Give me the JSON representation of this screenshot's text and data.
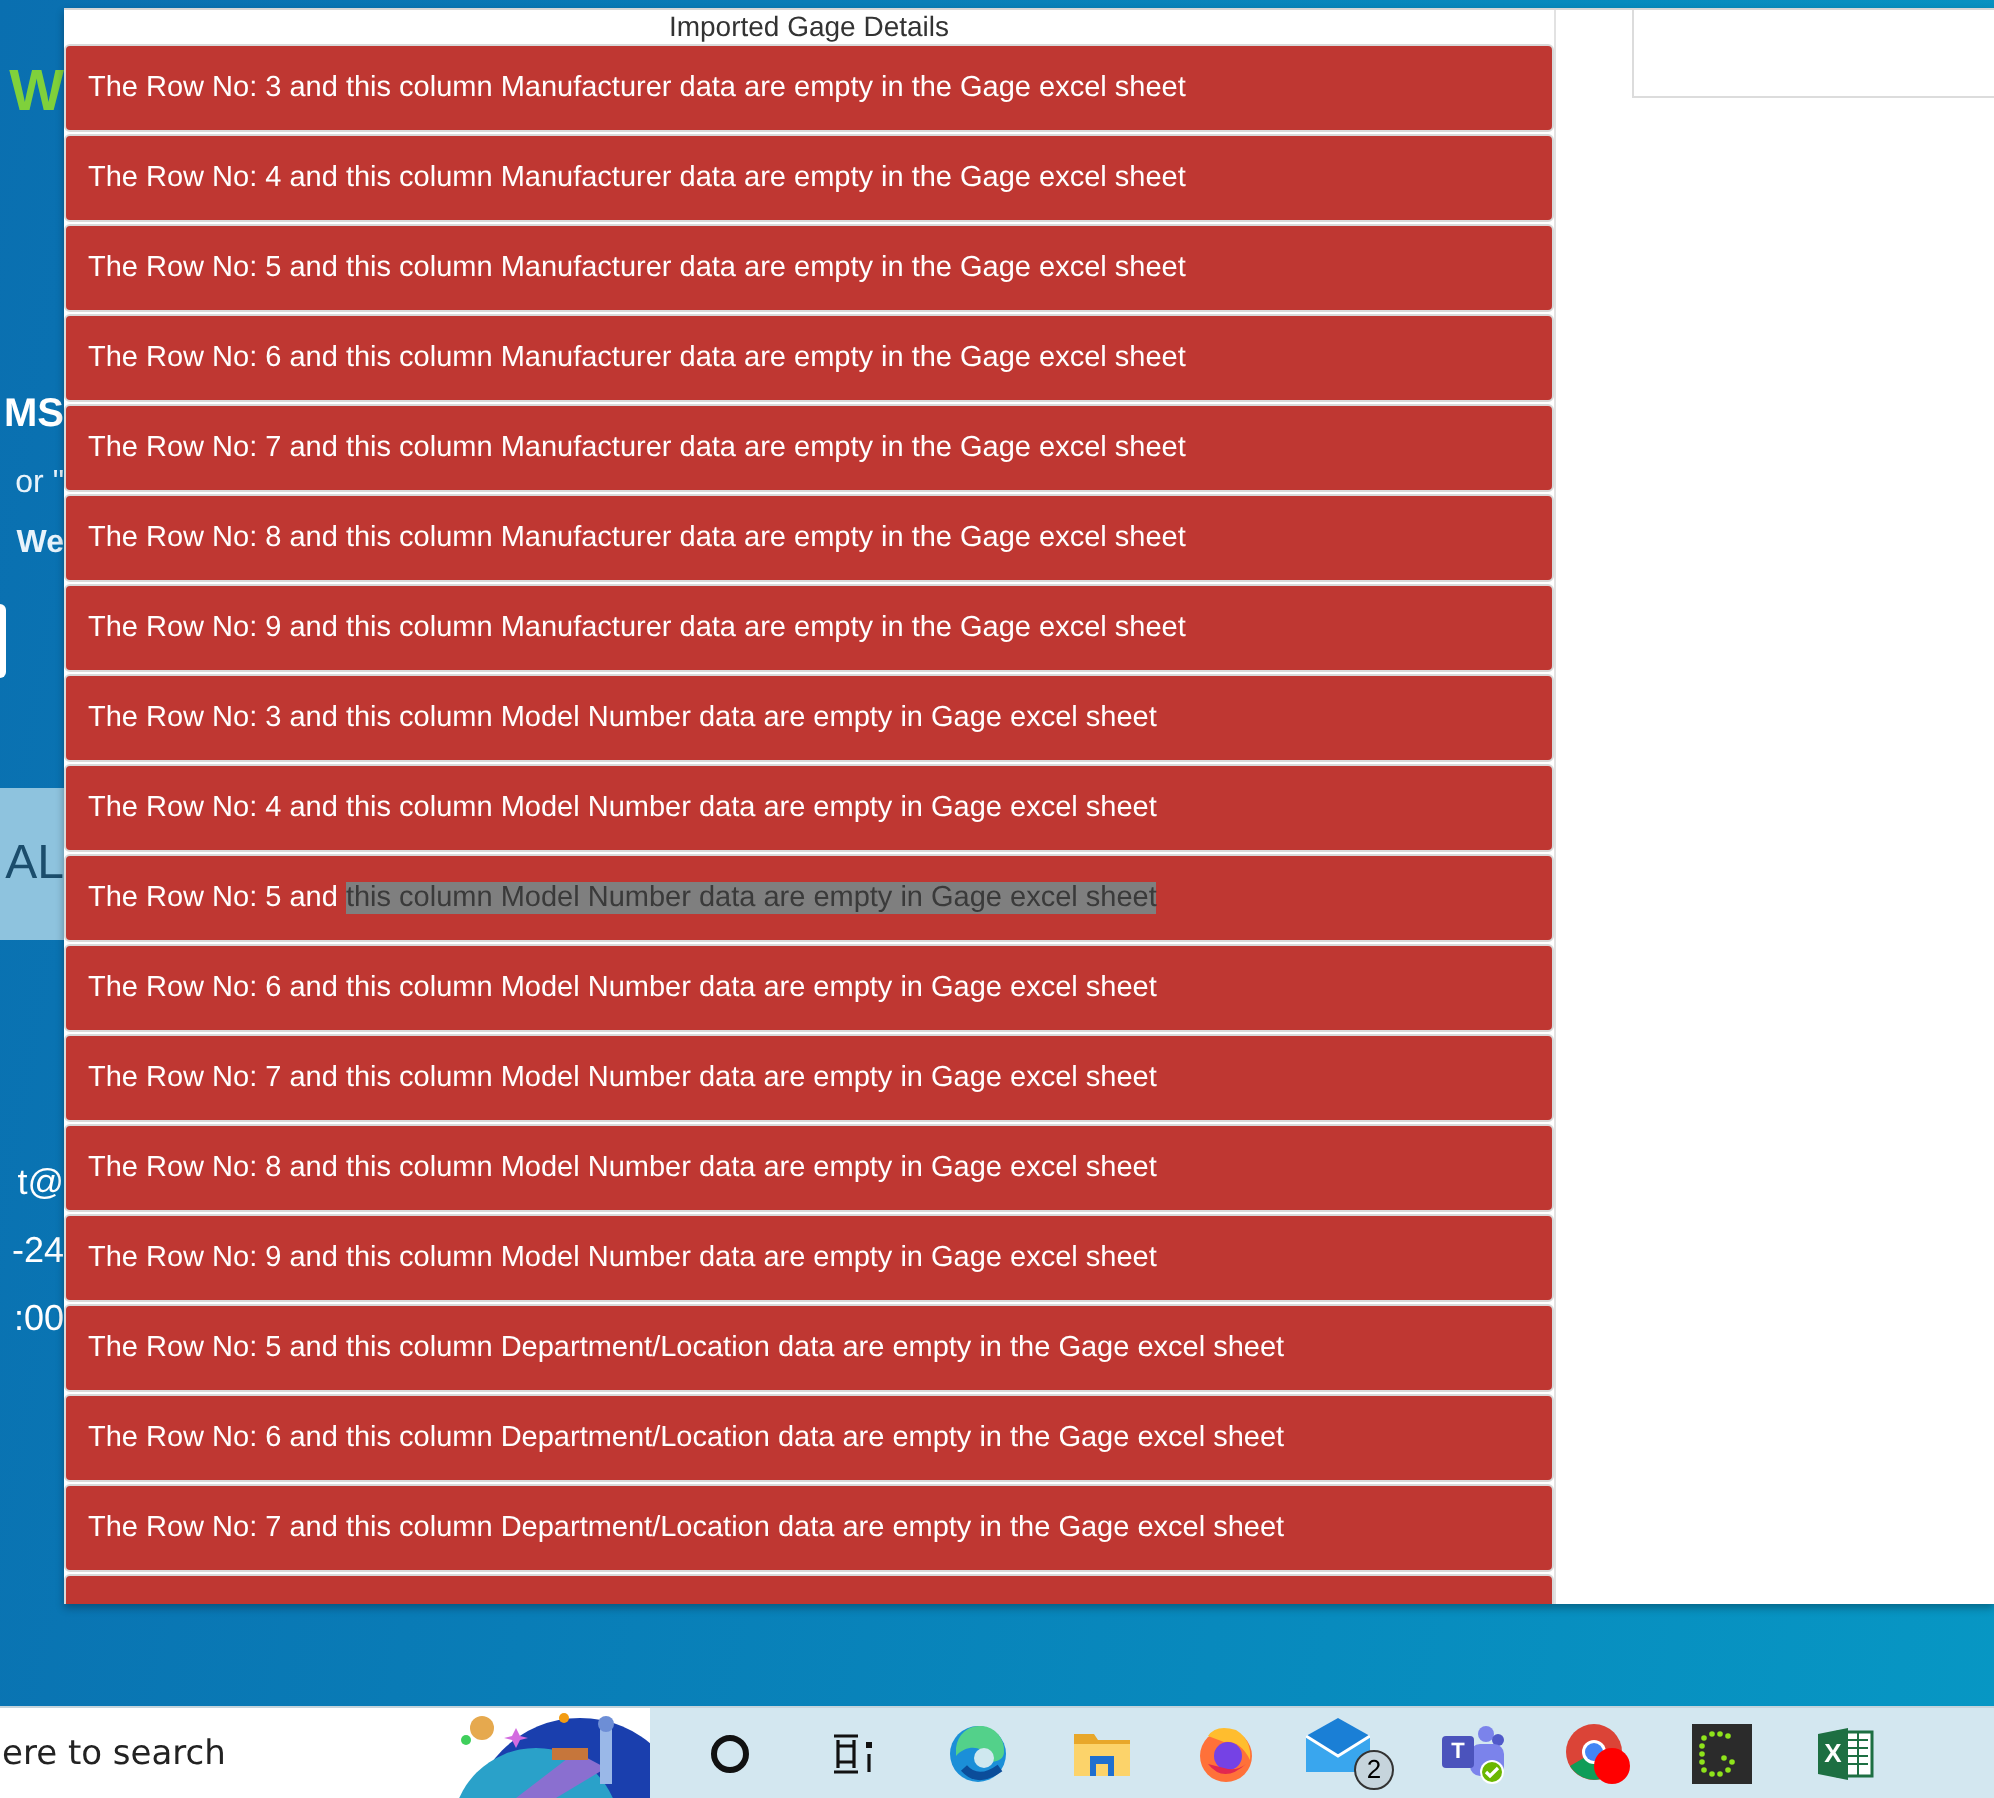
{
  "background_page": {
    "logo_fragment": "W",
    "heading_fragment": "MS",
    "line_fragments": [
      "or \"",
      "We"
    ],
    "band_fragment": "AL",
    "contact_fragments": [
      "t@",
      "-24",
      ":00"
    ]
  },
  "dialog": {
    "title": "Imported Gage Details",
    "rows": [
      {
        "text": "The Row No: 3 and this column Manufacturer data are empty in the Gage excel sheet"
      },
      {
        "text": "The Row No: 4 and this column Manufacturer data are empty in the Gage excel sheet"
      },
      {
        "text": "The Row No: 5 and this column Manufacturer data are empty in the Gage excel sheet"
      },
      {
        "text": "The Row No: 6 and this column Manufacturer data are empty in the Gage excel sheet"
      },
      {
        "text": "The Row No: 7 and this column Manufacturer data are empty in the Gage excel sheet"
      },
      {
        "text": "The Row No: 8 and this column Manufacturer data are empty in the Gage excel sheet"
      },
      {
        "text": "The Row No: 9 and this column Manufacturer data are empty in the Gage excel sheet"
      },
      {
        "text": "The Row No: 3 and this column Model Number data are empty in Gage excel sheet"
      },
      {
        "text": "The Row No: 4 and this column Model Number data are empty in Gage excel sheet"
      },
      {
        "text": "The Row No: 5 and ",
        "selected_text": "this column Model Number data are empty in Gage excel sheet"
      },
      {
        "text": "The Row No: 6 and this column Model Number data are empty in Gage excel sheet"
      },
      {
        "text": "The Row No: 7 and this column Model Number data are empty in Gage excel sheet"
      },
      {
        "text": "The Row No: 8 and this column Model Number data are empty in Gage excel sheet"
      },
      {
        "text": "The Row No: 9 and this column Model Number data are empty in Gage excel sheet"
      },
      {
        "text": "The Row No: 5 and this column Department/Location data are empty in the Gage excel sheet"
      },
      {
        "text": "The Row No: 6 and this column Department/Location data are empty in the Gage excel sheet"
      },
      {
        "text": "The Row No: 7 and this column Department/Location data are empty in the Gage excel sheet"
      }
    ]
  },
  "taskbar": {
    "search": {
      "placeholder": "ere to search"
    },
    "icons": [
      {
        "kind": "cortana"
      },
      {
        "kind": "taskview"
      },
      {
        "kind": "edge"
      },
      {
        "kind": "explorer"
      },
      {
        "kind": "firefox"
      },
      {
        "kind": "mail",
        "badge": "2"
      },
      {
        "kind": "teams",
        "glyph": "T"
      },
      {
        "kind": "chrome"
      },
      {
        "kind": "dots"
      },
      {
        "kind": "excel",
        "glyph": "X"
      }
    ]
  }
}
